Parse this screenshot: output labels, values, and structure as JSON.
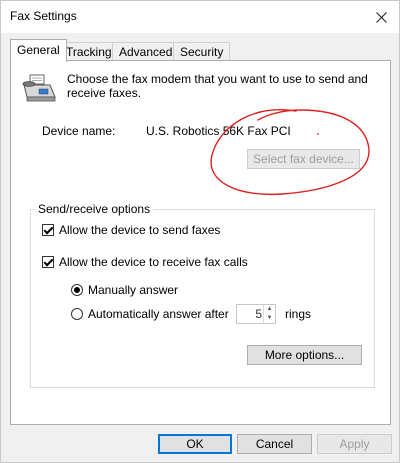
{
  "window": {
    "title": "Fax Settings"
  },
  "tabs": [
    {
      "label": "General"
    },
    {
      "label": "Tracking"
    },
    {
      "label": "Advanced"
    },
    {
      "label": "Security"
    }
  ],
  "general": {
    "description": "Choose the fax modem that you want to use to send and receive faxes.",
    "device_label": "Device name:",
    "device_value": "U.S. Robotics 56K Fax PCI",
    "select_device_label": "Select fax device...",
    "group_label": "Send/receive options",
    "allow_send": {
      "label": "Allow the device to send faxes",
      "checked": true
    },
    "allow_receive": {
      "label": "Allow the device to receive fax calls",
      "checked": true
    },
    "manual_answer": {
      "label": "Manually answer",
      "checked": true
    },
    "auto_answer": {
      "label": "Automatically answer after",
      "checked": false
    },
    "rings_value": "5",
    "rings_label": "rings",
    "more_options_label": "More options..."
  },
  "footer": {
    "ok": "OK",
    "cancel": "Cancel",
    "apply": "Apply"
  },
  "colors": {
    "annotation": "#e02020",
    "focus": "#0078d7"
  },
  "icons": {
    "close": "close-icon",
    "fax": "fax-machine-icon"
  }
}
